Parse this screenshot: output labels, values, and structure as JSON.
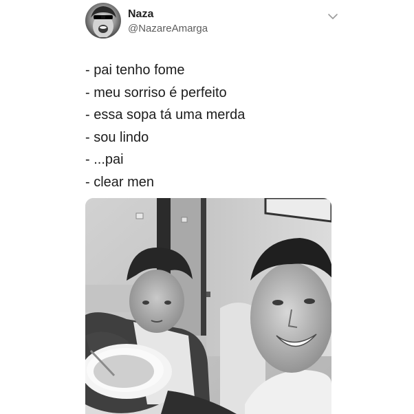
{
  "tweet": {
    "author": {
      "display_name": "Naza",
      "handle": "@NazareAmarga",
      "avatar_icon": "user-avatar-photo"
    },
    "menu_icon": "chevron-down-icon",
    "lines": [
      "- pai tenho fome",
      "- meu sorriso é perfeito",
      "- essa sopa tá uma merda",
      "- sou lindo",
      "- ...pai",
      "- clear men"
    ],
    "media": {
      "type": "photo",
      "style": "black-and-white"
    }
  },
  "colors": {
    "background": "#ffffff",
    "text": "#1c1c1c",
    "handle": "#5c5c5c",
    "chevron": "#9b9b9b"
  }
}
